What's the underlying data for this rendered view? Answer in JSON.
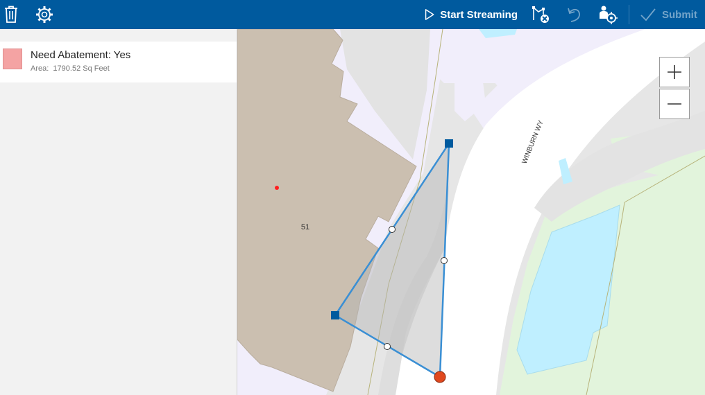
{
  "toolbar": {
    "delete_icon": "trash-icon",
    "settings_icon": "gear-icon",
    "start_streaming_label": "Start Streaming",
    "clear_vertex_icon": "clear-selection-icon",
    "undo_icon": "undo-icon",
    "gps_icon": "gps-vertex-icon",
    "submit_label": "Submit",
    "background_color": "#005a9e"
  },
  "legend": {
    "title": "Need Abatement: Yes",
    "area_label": "Area:",
    "area_value": "1790.52 Sq Feet",
    "swatch_color": "#f4a3a3"
  },
  "map": {
    "street_label": "WINBURN WY",
    "building_label": "51",
    "sketch_color": "#3a8fd4",
    "vertex_color": "#005a9e",
    "current_vertex_color": "#e0481e",
    "building_color": "#cbbfb0",
    "water_color": "#bfefff",
    "park_color": "#e2f4dc"
  },
  "zoom": {
    "zoom_in_icon": "plus-icon",
    "zoom_out_icon": "minus-icon"
  }
}
